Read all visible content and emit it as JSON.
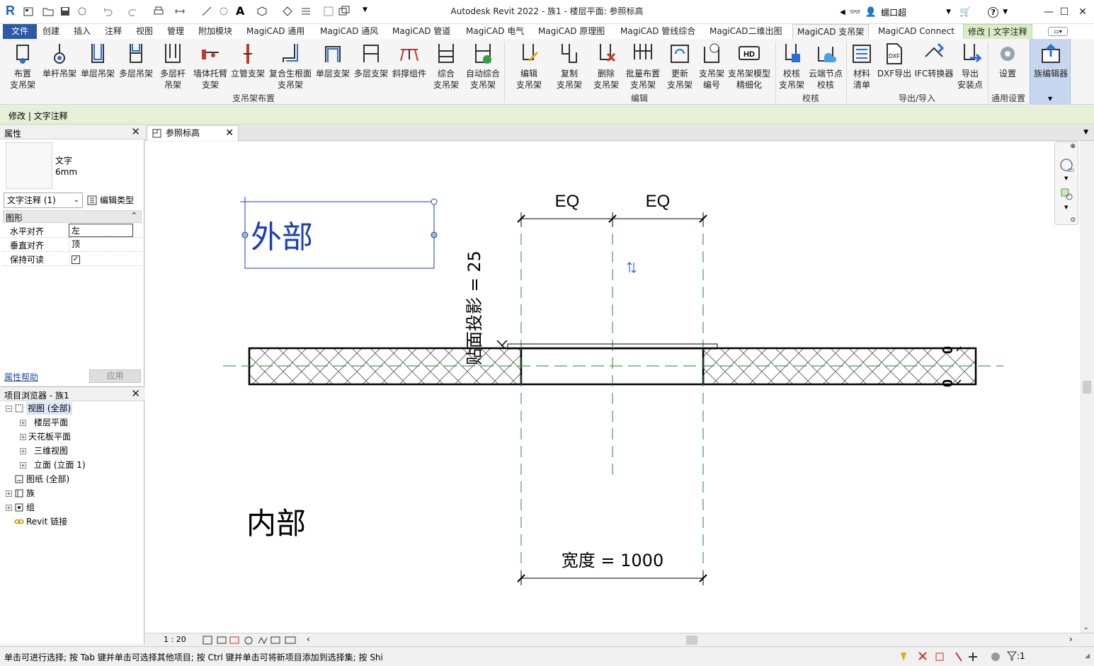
{
  "app": {
    "title": "Autodesk Revit 2022 - 族1 - 楼层平面: 参照标高",
    "user": "蠕口超",
    "help": "?",
    "logo": "R"
  },
  "tabs": [
    {
      "label": "文件"
    },
    {
      "label": "创建"
    },
    {
      "label": "插入"
    },
    {
      "label": "注释"
    },
    {
      "label": "视图"
    },
    {
      "label": "管理"
    },
    {
      "label": "附加模块"
    },
    {
      "label": "MagiCAD 通用"
    },
    {
      "label": "MagiCAD 通风"
    },
    {
      "label": "MagiCAD 管道"
    },
    {
      "label": "MagiCAD 电气"
    },
    {
      "label": "MagiCAD 原理图"
    },
    {
      "label": "MagiCAD 管线综合"
    },
    {
      "label": "MagiCAD二维出图"
    },
    {
      "label": "MagiCAD 支吊架"
    },
    {
      "label": "MagiCAD Connect"
    },
    {
      "label": "修改 | 文字注释"
    }
  ],
  "ribbon": {
    "buttons": [
      {
        "label": "布置\n支吊架",
        "icon": "place-hanger-icon"
      },
      {
        "label": "单杆吊架",
        "icon": "single-rod-hanger-icon"
      },
      {
        "label": "单层吊架",
        "icon": "single-layer-hanger-icon"
      },
      {
        "label": "多层吊架",
        "icon": "multi-layer-hanger-icon"
      },
      {
        "label": "多层杆\n吊架",
        "icon": "multi-rod-hanger-icon"
      },
      {
        "label": "墙体托臂\n支架",
        "icon": "wall-bracket-icon"
      },
      {
        "label": "立管支架",
        "icon": "riser-support-icon"
      },
      {
        "label": "复合生根面\n支吊架",
        "icon": "composite-root-icon"
      },
      {
        "label": "单层支架",
        "icon": "single-layer-support-icon"
      },
      {
        "label": "多层支架",
        "icon": "multi-layer-support-icon"
      },
      {
        "label": "斜撑组件",
        "icon": "diagonal-brace-icon"
      },
      {
        "label": "综合\n支吊架",
        "icon": "integrated-hanger-icon"
      },
      {
        "label": "自动综合\n支吊架",
        "icon": "auto-integrated-hanger-icon"
      },
      {
        "label": "编辑\n支吊架",
        "icon": "edit-hanger-icon"
      },
      {
        "label": "复制\n支吊架",
        "icon": "copy-hanger-icon"
      },
      {
        "label": "删除\n支吊架",
        "icon": "delete-hanger-icon"
      },
      {
        "label": "批量布置\n支吊架",
        "icon": "batch-place-icon"
      },
      {
        "label": "更新\n支吊架",
        "icon": "update-hanger-icon"
      },
      {
        "label": "支吊架\n编号",
        "icon": "hanger-number-icon"
      },
      {
        "label": "支吊架模型\n精细化",
        "icon": "hd-model-icon"
      },
      {
        "label": "校核\n支吊架",
        "icon": "check-hanger-icon"
      },
      {
        "label": "云端节点\n校核",
        "icon": "cloud-check-icon"
      },
      {
        "label": "材料\n清单",
        "icon": "material-list-icon"
      },
      {
        "label": "DXF导出",
        "icon": "dxf-export-icon"
      },
      {
        "label": "IFC转换器",
        "icon": "ifc-converter-icon"
      },
      {
        "label": "导出\n安装点",
        "icon": "export-points-icon"
      },
      {
        "label": "设置",
        "icon": "settings-gear-icon"
      },
      {
        "label": "族编辑器",
        "icon": "family-editor-icon"
      }
    ],
    "panels": [
      "支吊架布置",
      "编辑",
      "校核",
      "导出/导入",
      "通用设置"
    ]
  },
  "context_bar": {
    "label": "修改 | 文字注释"
  },
  "properties": {
    "title": "属性",
    "type_name": "文字\n6mm",
    "selector": "文字注释 (1)",
    "edit_type": "编辑类型",
    "group": "图形",
    "rows": [
      {
        "key": "水平对齐",
        "value": "左"
      },
      {
        "key": "垂直对齐",
        "value": "顶"
      },
      {
        "key": "保持可读",
        "value": "✓"
      }
    ],
    "help_link": "属性帮助",
    "apply": "应用"
  },
  "browser": {
    "title": "项目浏览器 - 族1",
    "items": [
      {
        "label": "视图 (全部)"
      },
      {
        "label": "楼层平面"
      },
      {
        "label": "天花板平面"
      },
      {
        "label": "三维视图"
      },
      {
        "label": "立面 (立面 1)"
      },
      {
        "label": "图纸 (全部)"
      },
      {
        "label": "族"
      },
      {
        "label": "组"
      },
      {
        "label": "Revit 链接"
      }
    ]
  },
  "document_tab": {
    "label": "参照标高"
  },
  "canvas": {
    "outer_text": "外部",
    "inner_text": "内部",
    "eq_left": "EQ",
    "eq_right": "EQ",
    "offset_label": "贴面投影 = 25",
    "width_label": "宽度 = 1000",
    "zero_top": "0",
    "zero_bottom": "0",
    "colors": {
      "text_blue": "#1c3fb5",
      "ref_green": "#1f8a2e",
      "line": "#000000"
    }
  },
  "view_bar": {
    "scale": "1 : 20"
  },
  "status": {
    "text": "单击可进行选择; 按 Tab 键并单击可选择其他项目; 按 Ctrl 键并单击可将新项目添加到选择集; 按 Shi",
    "filter": ":1"
  }
}
